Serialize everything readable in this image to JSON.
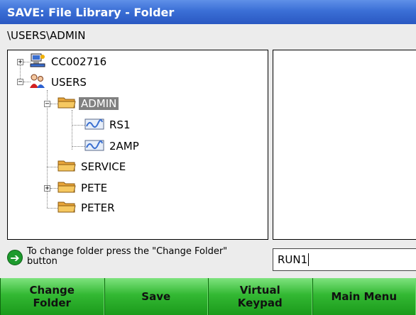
{
  "window": {
    "title": "SAVE: File Library - Folder"
  },
  "path": "\\USERS\\ADMIN",
  "tree": {
    "computer": "CC002716",
    "users": "USERS",
    "admin": "ADMIN",
    "rs1": "RS1",
    "amp2": "2AMP",
    "service": "SERVICE",
    "pete": "PETE",
    "peter": "PETER",
    "expand_plus": "+",
    "expand_minus": "−"
  },
  "hint": {
    "text": "To change folder press the \"Change Folder\" button",
    "icon": "arrow-right-icon"
  },
  "filename_value": "RUN1",
  "toolbar": {
    "change_folder": "Change\nFolder",
    "save": "Save",
    "virtual_keypad": "Virtual\nKeypad",
    "main_menu": "Main Menu"
  },
  "colors": {
    "titlebar": "#3b6fd6",
    "toolbar_green": "#33b833",
    "selection": "#808080",
    "folder": "#f0b84a"
  }
}
